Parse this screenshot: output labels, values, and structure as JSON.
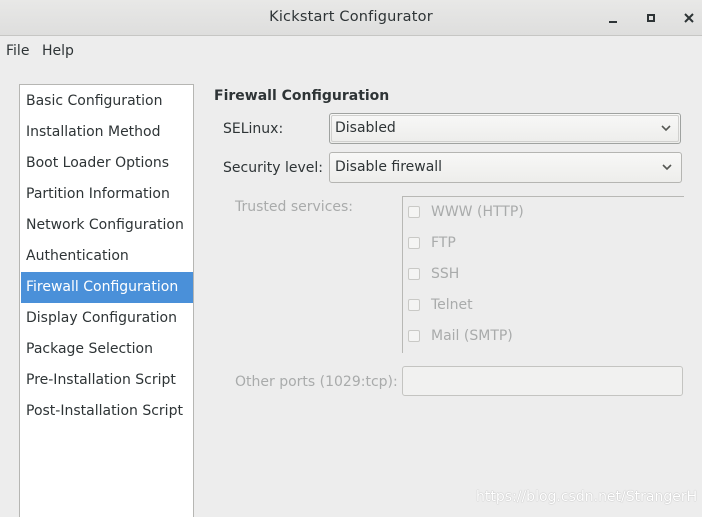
{
  "window": {
    "title": "Kickstart Configurator",
    "minimize_icon": "minimize-icon",
    "maximize_icon": "maximize-icon",
    "close_icon": "close-icon"
  },
  "menubar": {
    "file": "File",
    "help": "Help"
  },
  "sidebar": {
    "items": [
      {
        "label": "Basic Configuration",
        "selected": false
      },
      {
        "label": "Installation Method",
        "selected": false
      },
      {
        "label": "Boot Loader Options",
        "selected": false
      },
      {
        "label": "Partition Information",
        "selected": false
      },
      {
        "label": "Network Configuration",
        "selected": false
      },
      {
        "label": "Authentication",
        "selected": false
      },
      {
        "label": "Firewall Configuration",
        "selected": true
      },
      {
        "label": "Display Configuration",
        "selected": false
      },
      {
        "label": "Package Selection",
        "selected": false
      },
      {
        "label": "Pre-Installation Script",
        "selected": false
      },
      {
        "label": "Post-Installation Script",
        "selected": false
      }
    ]
  },
  "firewall": {
    "section_title": "Firewall Configuration",
    "selinux_label": "SELinux:",
    "selinux_value": "Disabled",
    "security_label": "Security level:",
    "security_value": "Disable firewall",
    "trusted_label": "Trusted services:",
    "services": [
      {
        "label": "WWW (HTTP)",
        "checked": false
      },
      {
        "label": "FTP",
        "checked": false
      },
      {
        "label": "SSH",
        "checked": false
      },
      {
        "label": "Telnet",
        "checked": false
      },
      {
        "label": "Mail (SMTP)",
        "checked": false
      }
    ],
    "other_ports_label": "Other ports (1029:tcp):",
    "other_ports_value": ""
  },
  "watermark": "https://blog.csdn.net/StrangerH",
  "colors": {
    "selection": "#4a90d9",
    "window_bg": "#ededed",
    "disabled_text": "#a9abab"
  }
}
